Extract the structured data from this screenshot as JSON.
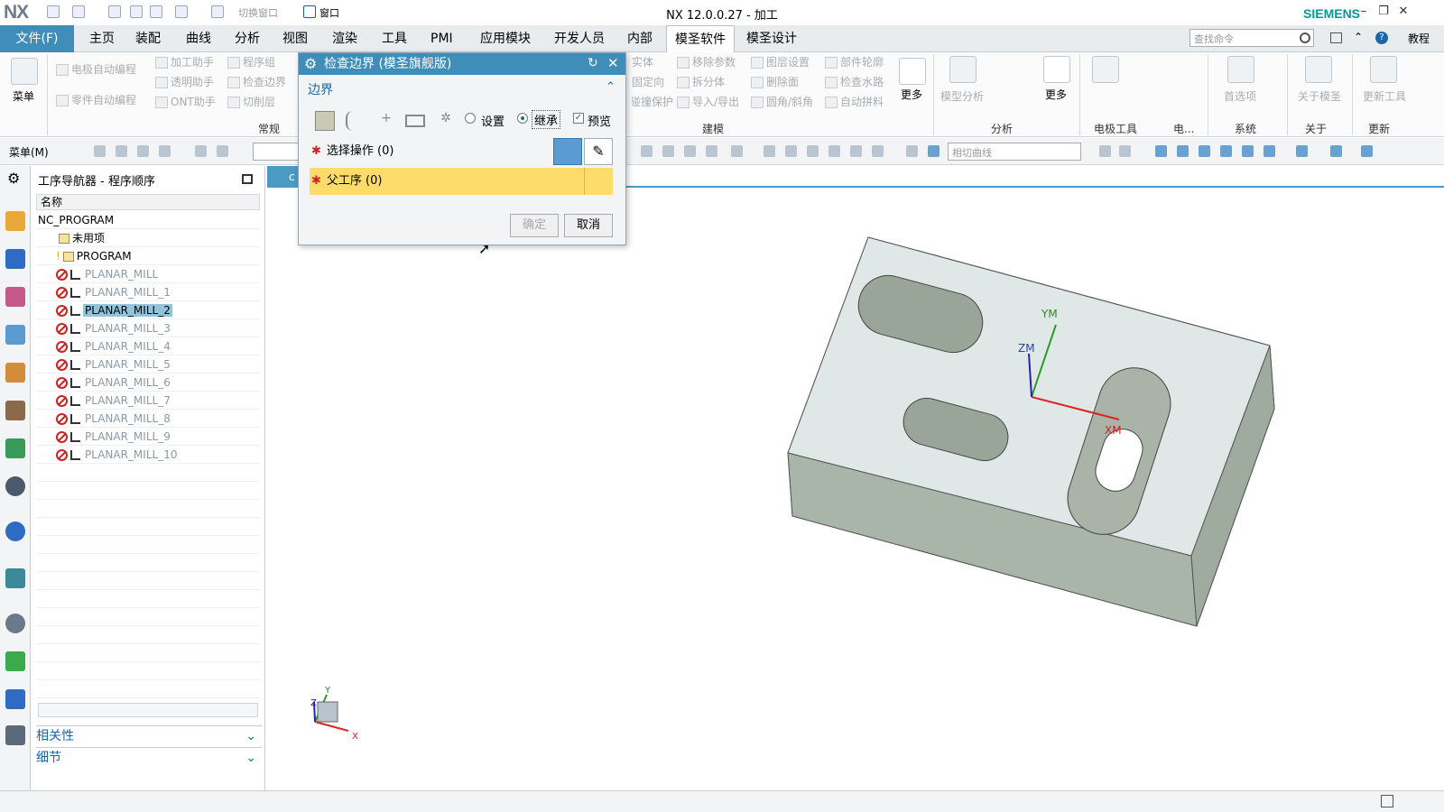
{
  "app": {
    "logo": "NX",
    "title": "NX 12.0.0.27 - 加工",
    "brand": "SIEMENS",
    "quick_access": {
      "switch_window": "切换窗口",
      "window": "窗口"
    }
  },
  "menubar": {
    "file": "文件(F)",
    "tabs": [
      "主页",
      "装配",
      "曲线",
      "分析",
      "视图",
      "渲染",
      "工具",
      "PMI",
      "应用模块",
      "开发人员",
      "内部",
      "模圣软件",
      "模圣设计"
    ],
    "active_tab": "模圣软件",
    "search_placeholder": "查找命令",
    "help_label": "教程"
  },
  "ribbon": {
    "menu_label": "菜单",
    "common": {
      "items": [
        "电极自动编程",
        "加工助手",
        "程序组",
        "零件自动编程",
        "透明助手",
        "检查边界",
        "ONT助手",
        "切削层"
      ],
      "group": "常规"
    },
    "modeling": {
      "items": [
        "实体",
        "移除参数",
        "图层设置",
        "部件轮廓",
        "固定向",
        "拆分体",
        "删除面",
        "检查水路",
        "碰撞保护",
        "导入/导出",
        "圆角/斜角",
        "自动拼料"
      ],
      "more": "更多",
      "group": "建模"
    },
    "analysis": {
      "model_analysis": "模型分析",
      "more": "更多",
      "group": "分析"
    },
    "electrode": {
      "group": "电极工具",
      "group2": "电..."
    },
    "system": {
      "first": "首选项",
      "group": "系统"
    },
    "about": {
      "label": "关于模圣",
      "group": "关于"
    },
    "update": {
      "label": "更新工具",
      "group": "更新"
    }
  },
  "toolbar2": {
    "menu": "菜单(M)",
    "curve_select": "相切曲线"
  },
  "navigator": {
    "title": "工序导航器 - 程序顺序",
    "column_header": "名称",
    "root": "NC_PROGRAM",
    "unused": "未用项",
    "program": "PROGRAM",
    "operations": [
      "PLANAR_MILL",
      "PLANAR_MILL_1",
      "PLANAR_MILL_2",
      "PLANAR_MILL_3",
      "PLANAR_MILL_4",
      "PLANAR_MILL_5",
      "PLANAR_MILL_6",
      "PLANAR_MILL_7",
      "PLANAR_MILL_8",
      "PLANAR_MILL_9",
      "PLANAR_MILL_10"
    ],
    "selected": "PLANAR_MILL_2",
    "footer_relevance": "相关性",
    "footer_details": "细节"
  },
  "viewport": {
    "tab_label": "c",
    "axis_labels": {
      "ym": "YM",
      "zm": "ZM",
      "xm": "XM"
    },
    "triad": {
      "x": "X",
      "y": "Y",
      "z": "Z"
    }
  },
  "dialog": {
    "title": "检查边界 (模圣旗舰版)",
    "section": "边界",
    "radio_setting": "设置",
    "radio_inherit": "继承",
    "preview": "预览",
    "select_operation": "选择操作 (0)",
    "parent_operation": "父工序 (0)",
    "ok": "确定",
    "cancel": "取消"
  },
  "colors": {
    "accent": "#3e8eb9",
    "highlight": "#fedc6c",
    "selection": "#91c5dc"
  }
}
